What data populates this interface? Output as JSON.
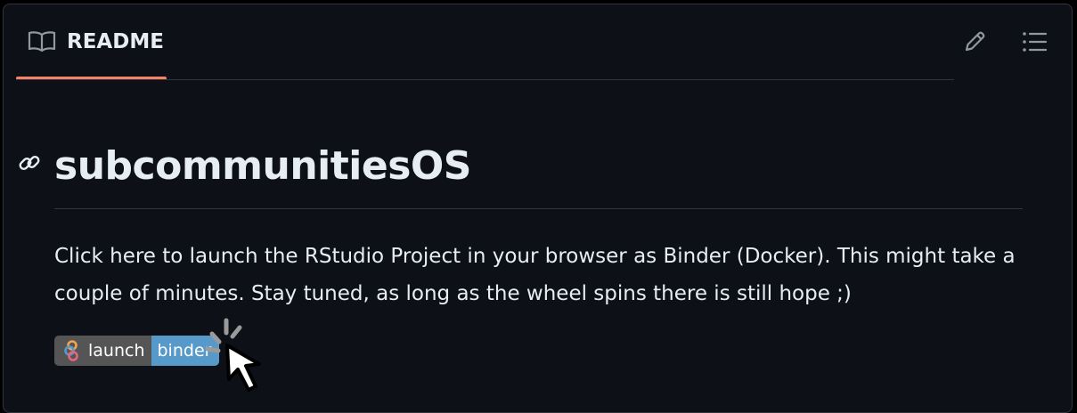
{
  "header": {
    "tab_label": "README"
  },
  "content": {
    "title": "subcommunitiesOS",
    "paragraph": "Click here to launch the RStudio Project in your browser as Binder (Docker). This might take a couple of minutes. Stay tuned, as long as the wheel spins there is still hope ;)",
    "badge": {
      "left_label": "launch",
      "right_label": "binder"
    }
  },
  "colors": {
    "page_background": "#0d1117",
    "border": "#30363d",
    "text": "#e6edf3",
    "muted_icon": "#848d97",
    "active_tab_underline": "#f78166",
    "badge_left": "#555555",
    "badge_right": "#579aca"
  },
  "icons": {
    "tab": "book-icon",
    "edit": "pencil-icon",
    "outline": "list-icon",
    "anchor": "link-icon",
    "badge": "binder-logo",
    "pointer": "click-cursor-icon"
  }
}
